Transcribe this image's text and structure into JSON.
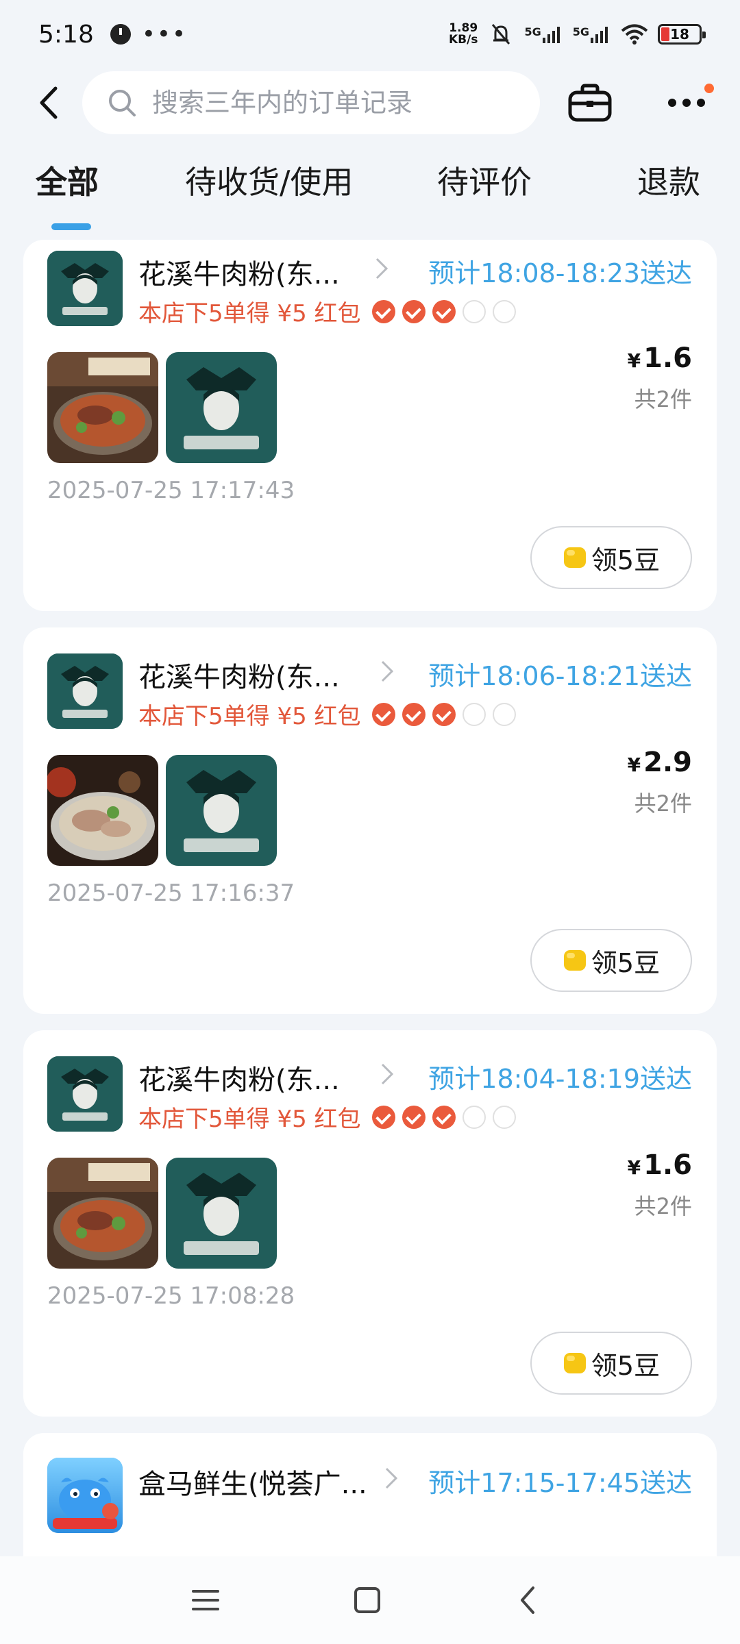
{
  "status_bar": {
    "time": "5:18",
    "net_speed_value": "1.89",
    "net_speed_unit": "KB/s",
    "signal1_label": "5G",
    "signal2_label": "5G",
    "battery": "18"
  },
  "header": {
    "search_placeholder": "搜索三年内的订单记录"
  },
  "tabs": [
    {
      "label": "全部",
      "active": true
    },
    {
      "label": "待收货/使用",
      "active": false
    },
    {
      "label": "待评价",
      "active": false
    },
    {
      "label": "退款",
      "active": false
    }
  ],
  "orders": [
    {
      "shop": "花溪牛肉粉(东...",
      "eta": "预计18:08-18:23送达",
      "promo": "本店下5单得 ¥5 红包",
      "stamps_done": 3,
      "stamps_total": 5,
      "currency": "¥",
      "price": "1.6",
      "count": "共2件",
      "time": "2025-07-25 17:17:43",
      "beans_label": "领5豆"
    },
    {
      "shop": "花溪牛肉粉(东...",
      "eta": "预计18:06-18:21送达",
      "promo": "本店下5单得 ¥5 红包",
      "stamps_done": 3,
      "stamps_total": 5,
      "currency": "¥",
      "price": "2.9",
      "count": "共2件",
      "time": "2025-07-25 17:16:37",
      "beans_label": "领5豆"
    },
    {
      "shop": "花溪牛肉粉(东...",
      "eta": "预计18:04-18:19送达",
      "promo": "本店下5单得 ¥5 红包",
      "stamps_done": 3,
      "stamps_total": 5,
      "currency": "¥",
      "price": "1.6",
      "count": "共2件",
      "time": "2025-07-25 17:08:28",
      "beans_label": "领5豆"
    },
    {
      "shop": "盒马鲜生(悦荟广...",
      "eta": "预计17:15-17:45送达"
    }
  ],
  "colors": {
    "background": "#f2f5f9",
    "accent_blue": "#3fa4e3",
    "promo_red": "#e2573a",
    "shop_logo_teal": "#215d5a"
  }
}
